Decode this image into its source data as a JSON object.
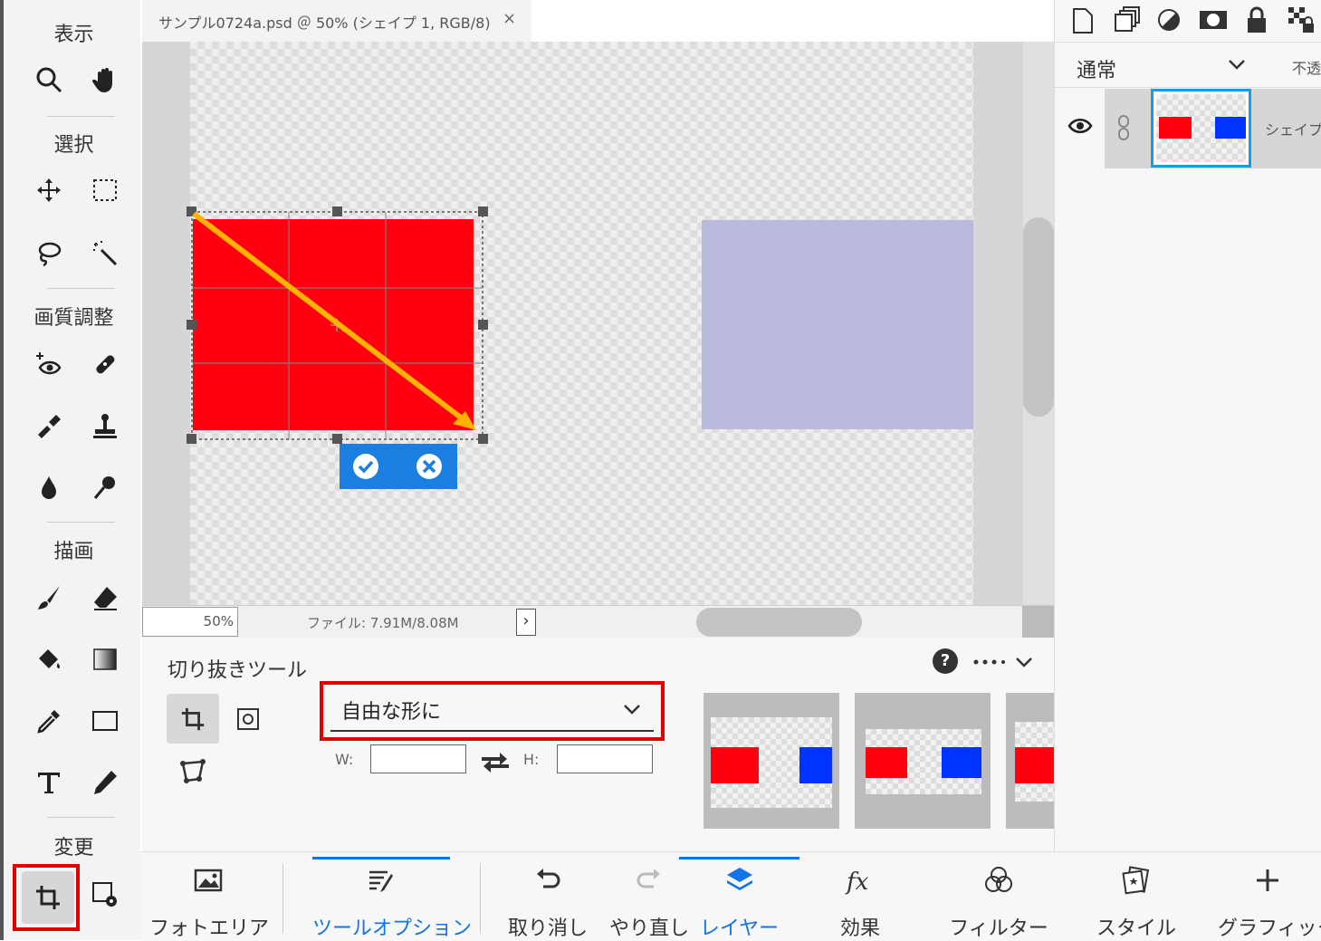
{
  "toolbar": {
    "section_view": "表示",
    "section_select": "選択",
    "section_adjust": "画質調整",
    "section_draw": "描画",
    "section_modify": "変更"
  },
  "document": {
    "tab_title": "サンプル0724a.psd ＠ 50% (シェイプ 1, RGB/8)",
    "close_glyph": "×"
  },
  "status": {
    "zoom": "50%",
    "file_info": "ファイル: 7.91M/8.08M",
    "expand_glyph": "›"
  },
  "tool_options": {
    "title": "切り抜きツール",
    "aspect_selected": "自由な形に",
    "width_label": "W:",
    "height_label": "H:",
    "width_value": "",
    "height_value": "",
    "help_more": "?"
  },
  "layers_panel": {
    "blend_mode": "通常",
    "opacity_label": "不透",
    "layer_name": "シェイプ"
  },
  "bottom_bar": {
    "photo_area": "フォトエリア",
    "tool_options": "ツールオプション",
    "undo": "取り消し",
    "redo": "やり直し",
    "layers": "レイヤー",
    "effects": "効果",
    "filters": "フィルター",
    "styles": "スタイル",
    "graphics": "グラフィック"
  },
  "colors": {
    "accent": "#1473e6",
    "highlight_red": "#e00000",
    "shape_red": "#ff0010",
    "shape_lavender": "#b9badc",
    "arrow": "#ffb300",
    "thumb_blue": "#0033ff",
    "confirm_bar": "#1a7fe0"
  }
}
